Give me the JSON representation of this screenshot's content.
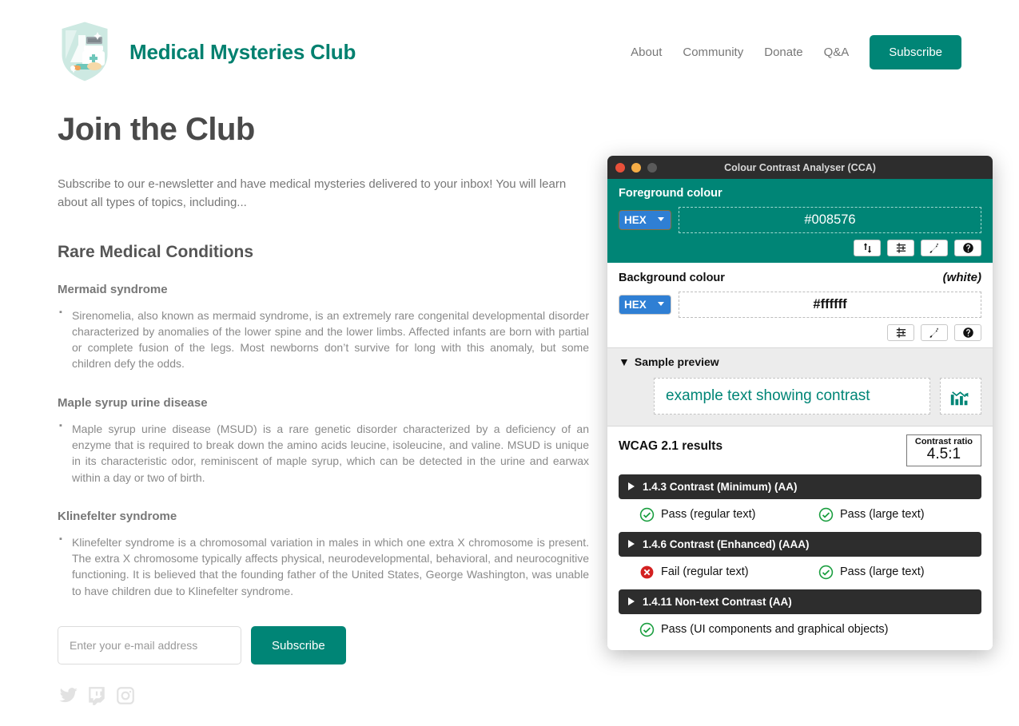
{
  "brand": {
    "name": "Medical Mysteries Club",
    "logo_icon": "medical-shield-logo"
  },
  "nav": {
    "links": [
      {
        "label": "About"
      },
      {
        "label": "Community"
      },
      {
        "label": "Donate"
      },
      {
        "label": "Q&A"
      }
    ],
    "subscribe_label": "Subscribe"
  },
  "main": {
    "title": "Join the Club",
    "intro": "Subscribe to our e-newsletter and have medical mysteries delivered to your inbox! You will learn about all types of topics, including...",
    "section_title": "Rare Medical Conditions",
    "conditions": [
      {
        "name": "Mermaid syndrome",
        "body": "Sirenomelia, also known as mermaid syndrome, is an extremely rare congenital developmental disorder characterized by anomalies of the lower spine and the lower limbs. Affected infants are born with partial or complete fusion of the legs. Most newborns don’t survive for long with this anomaly, but some children defy the odds."
      },
      {
        "name": "Maple syrup urine disease",
        "body": "Maple syrup urine disease (MSUD) is a rare genetic disorder characterized by a deficiency of an enzyme that is required to break down the amino acids leucine, isoleucine, and valine. MSUD is unique in its characteristic odor, reminiscent of maple syrup, which can be detected in the urine and earwax within a day or two of birth."
      },
      {
        "name": "Klinefelter syndrome",
        "body": "Klinefelter syndrome is a chromosomal variation in males in which one extra X chromosome is present. The extra X chromosome typically affects physical, neurodevelopmental, behavioral, and neurocognitive functioning. It is believed that the founding father of the United States, George Washington, was unable to have children due to Klinefelter syndrome."
      }
    ],
    "form": {
      "email_placeholder": "Enter your e-mail address",
      "email_value": "",
      "submit_label": "Subscribe"
    },
    "socials": [
      {
        "icon": "twitter-icon"
      },
      {
        "icon": "twitch-icon"
      },
      {
        "icon": "instagram-icon"
      }
    ]
  },
  "cca": {
    "window_title": "Colour Contrast Analyser (CCA)",
    "foreground": {
      "label": "Foreground colour",
      "format": "HEX",
      "value": "#008576",
      "tools": [
        "swap-icon",
        "sliders-icon",
        "eyedropper-icon",
        "help-icon"
      ]
    },
    "background": {
      "label": "Background colour",
      "note": "(white)",
      "format": "HEX",
      "value": "#ffffff",
      "tools": [
        "sliders-icon",
        "eyedropper-icon",
        "help-icon"
      ]
    },
    "preview": {
      "label": "Sample preview",
      "sample_text": "example text showing contrast",
      "icon": "bar-chart-down-icon"
    },
    "results": {
      "title": "WCAG 2.1 results",
      "ratio_label": "Contrast ratio",
      "ratio_value": "4.5:1",
      "criteria": [
        {
          "name": "1.4.3 Contrast (Minimum) (AA)",
          "results": [
            {
              "status": "pass",
              "text": "Pass (regular text)"
            },
            {
              "status": "pass",
              "text": "Pass (large text)"
            }
          ]
        },
        {
          "name": "1.4.6 Contrast (Enhanced) (AAA)",
          "results": [
            {
              "status": "fail",
              "text": "Fail (regular text)"
            },
            {
              "status": "pass",
              "text": "Pass (large text)"
            }
          ]
        },
        {
          "name": "1.4.11 Non-text Contrast (AA)",
          "results": [
            {
              "status": "pass",
              "text": "Pass (UI components and graphical objects)"
            }
          ]
        }
      ]
    }
  },
  "colors": {
    "brand_teal": "#008576",
    "brand_teal_dark": "#00806f",
    "pass_green": "#1a9e3f",
    "fail_red": "#d32020",
    "titlebar": "#2d2d2d"
  }
}
